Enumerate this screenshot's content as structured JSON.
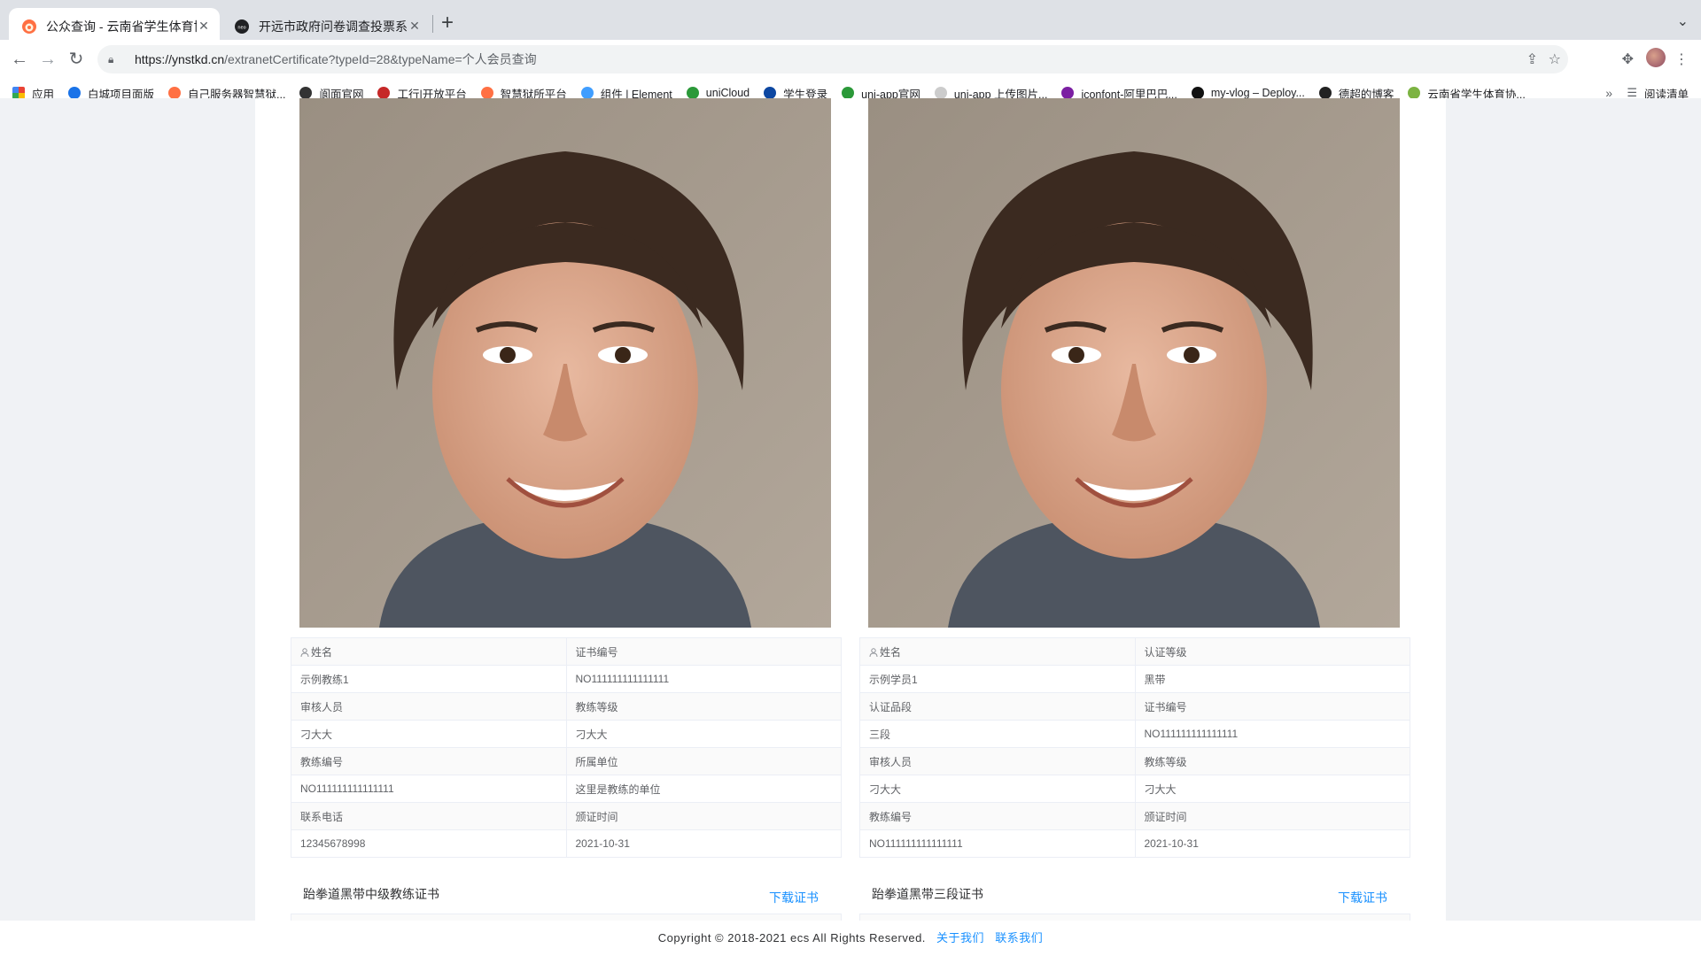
{
  "browser": {
    "tabs": [
      {
        "title": "公众查询 - 云南省学生体育协会",
        "active": true
      },
      {
        "title": "开远市政府问卷调查投票系统 | 旧",
        "active": false
      }
    ],
    "url_host": "https://ynstkd.cn",
    "url_path": "/extranetCertificate?typeId=28&typeName=个人会员查询",
    "bookmarks": [
      {
        "label": "应用",
        "color": "#4285f4"
      },
      {
        "label": "白城项目面版",
        "color": "#1a73e8"
      },
      {
        "label": "自己服务器智慧狱...",
        "color": "#ff7043"
      },
      {
        "label": "阆面官网",
        "color": "#333333"
      },
      {
        "label": "工行|开放平台",
        "color": "#c62828"
      },
      {
        "label": "智慧狱所平台",
        "color": "#ff7043"
      },
      {
        "label": "组件 | Element",
        "color": "#409eff"
      },
      {
        "label": "uniCloud",
        "color": "#2b9939"
      },
      {
        "label": "学生登录",
        "color": "#0d47a1"
      },
      {
        "label": "uni-app官网",
        "color": "#2b9939"
      },
      {
        "label": "uni-app 上传图片...",
        "color": "#cccccc"
      },
      {
        "label": "iconfont-阿里巴巴...",
        "color": "#7b1fa2"
      },
      {
        "label": "my-vlog – Deploy...",
        "color": "#111111"
      },
      {
        "label": "德超的博客",
        "color": "#222222"
      },
      {
        "label": "云南省学生体育协...",
        "color": "#7cb342"
      }
    ],
    "bookmarks_more": "»",
    "reading_list": "阅读清单"
  },
  "cards": [
    {
      "rows": [
        [
          "姓名",
          "证书编号"
        ],
        [
          "示例教练1",
          "NO111111111111111"
        ],
        [
          "审核人员",
          "教练等级"
        ],
        [
          "刁大大",
          "刁大大"
        ],
        [
          "教练编号",
          "所属单位"
        ],
        [
          "NO111111111111111",
          "这里是教练的单位"
        ],
        [
          "联系电话",
          "颁证时间"
        ],
        [
          "12345678998",
          "2021-10-31"
        ]
      ],
      "next_title": "跆拳道黑带中级教练证书",
      "download": "下载证书"
    },
    {
      "rows": [
        [
          "姓名",
          "认证等级"
        ],
        [
          "示例学员1",
          "黑带"
        ],
        [
          "认证品段",
          "证书编号"
        ],
        [
          "三段",
          "NO111111111111111"
        ],
        [
          "审核人员",
          "教练等级"
        ],
        [
          "刁大大",
          "刁大大"
        ],
        [
          "教练编号",
          "颁证时间"
        ],
        [
          "NO111111111111111",
          "2021-10-31"
        ]
      ],
      "next_title": "跆拳道黑带三段证书",
      "download": "下载证书"
    }
  ],
  "footer": {
    "copyright": "Copyright © 2018-2021 ecs All Rights Reserved.",
    "about": "关于我们",
    "contact": "联系我们"
  }
}
